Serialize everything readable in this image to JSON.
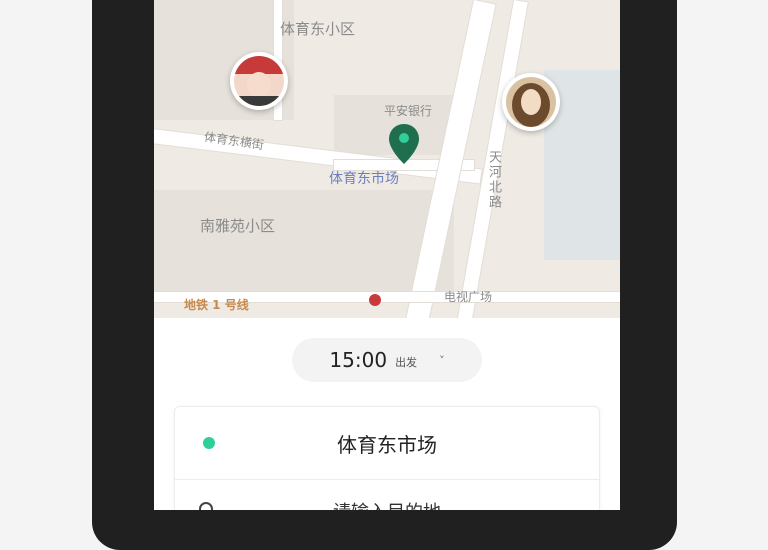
{
  "map": {
    "labels": {
      "neighborhood_north": "体育东小区",
      "neighborhood_south": "南雅苑小区",
      "bank": "平安银行",
      "road_west": "体育东横街",
      "market": "体育东市场",
      "road_vertical": "天河北路",
      "plaza": "电视广场",
      "metro": "地铁 1 号线"
    },
    "pin_color": "#1f6f4e",
    "market_color": "#6b7fbc"
  },
  "time_selector": {
    "value": "15:00",
    "suffix": "出发",
    "chevron": "˅"
  },
  "trip": {
    "origin": "体育东市场",
    "origin_dot_color": "#2fcf9b",
    "destination": "请输入目的地"
  }
}
